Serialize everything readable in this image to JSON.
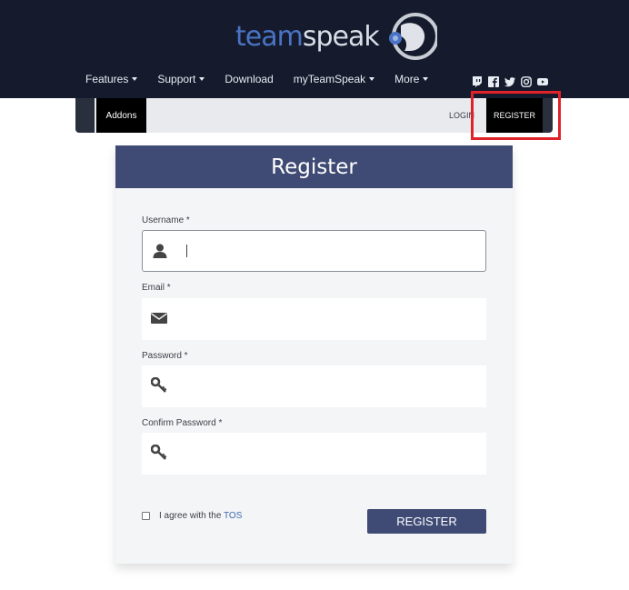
{
  "header": {
    "logo_team": "team",
    "logo_speak": "speak",
    "nav": [
      {
        "label": "Features",
        "has_caret": true
      },
      {
        "label": "Support",
        "has_caret": true
      },
      {
        "label": "Download",
        "has_caret": false
      },
      {
        "label": "myTeamSpeak",
        "has_caret": true
      },
      {
        "label": "More",
        "has_caret": true
      }
    ],
    "social_icons": [
      "twitch-icon",
      "facebook-icon",
      "twitter-icon",
      "instagram-icon",
      "youtube-icon"
    ]
  },
  "subnav": {
    "addons": "Addons",
    "login": "LOGIN",
    "register": "REGISTER"
  },
  "form": {
    "title": "Register",
    "username_label": "Username *",
    "email_label": "Email *",
    "password_label": "Password *",
    "confirm_label": "Confirm Password *",
    "agree_text": "I agree with the",
    "tos_link": "TOS",
    "submit_label": "REGISTER"
  },
  "colors": {
    "header_bg": "#151b2d",
    "accent": "#3f4b74",
    "highlight": "#e0222a"
  }
}
